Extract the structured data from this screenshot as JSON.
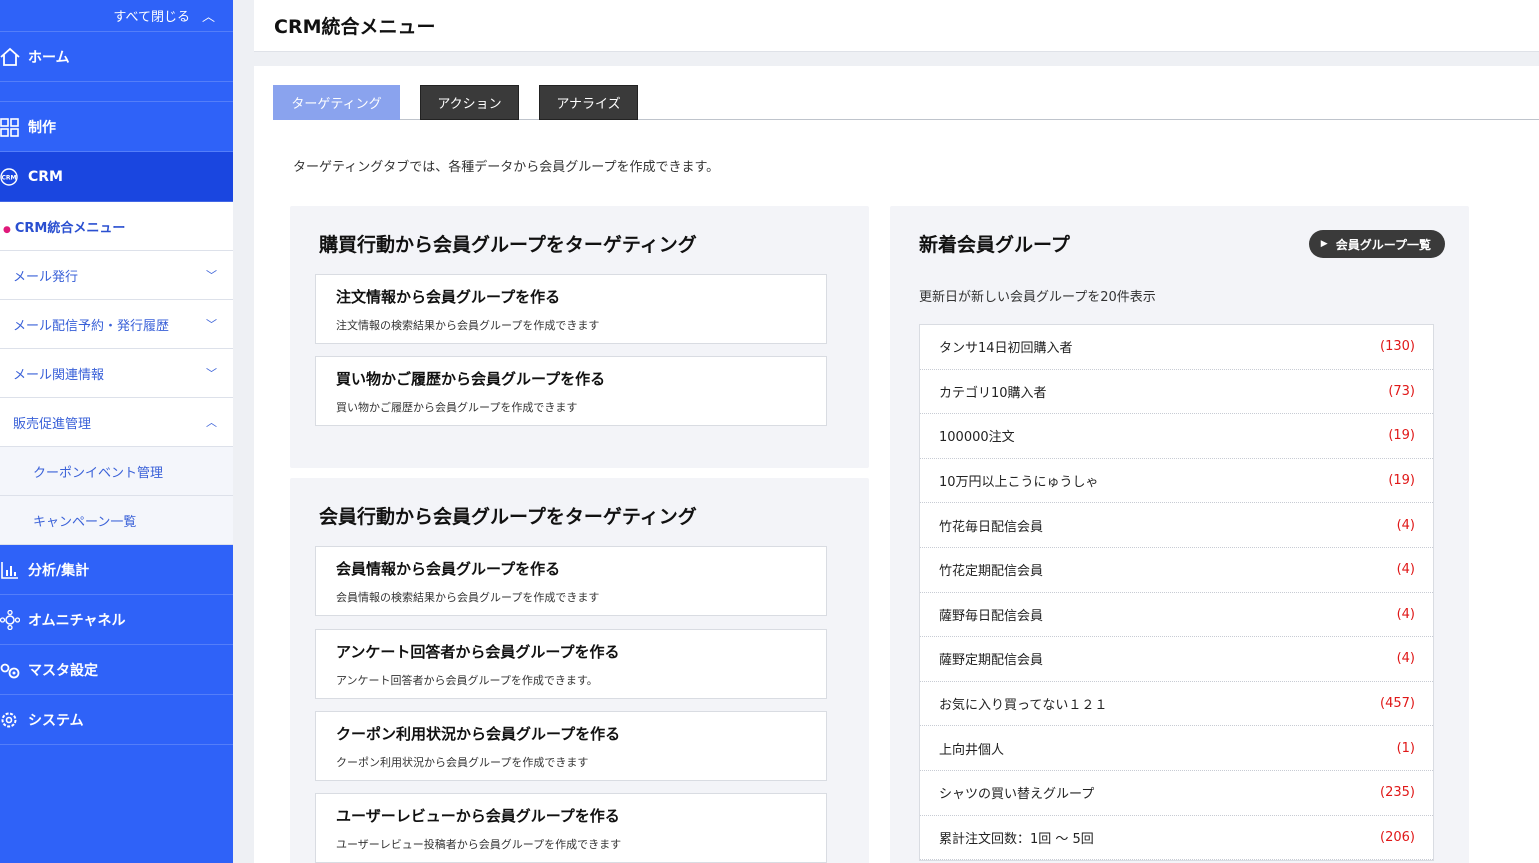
{
  "sidebar": {
    "collapse_all": "すべて閉じる",
    "home": "ホーム",
    "production": "制作",
    "crm": "CRM",
    "crm_icon_text": "CRM",
    "crm_menu": "CRM統合メニュー",
    "sub_items": [
      {
        "label": "メール発行",
        "state": "collapsed"
      },
      {
        "label": "メール配信予約・発行履歴",
        "state": "collapsed"
      },
      {
        "label": "メール関連情報",
        "state": "collapsed"
      },
      {
        "label": "販売促進管理",
        "state": "expanded"
      }
    ],
    "promo_children": [
      "クーポンイベント管理",
      "キャンペーン一覧"
    ],
    "analysis": "分析/集計",
    "omni": "オムニチャネル",
    "master": "マスタ設定",
    "system": "システム",
    "colors": {
      "bg": "#2f62f8",
      "active": "#1a46e0"
    }
  },
  "header": {
    "title": "CRM統合メニュー"
  },
  "tabs": [
    {
      "label": "ターゲティング",
      "active": true
    },
    {
      "label": "アクション",
      "active": false
    },
    {
      "label": "アナライズ",
      "active": false
    }
  ],
  "intro": "ターゲティングタブでは、各種データから会員グループを作成できます。",
  "purchase_card": {
    "title": "購買行動から会員グループをターゲティング",
    "items": [
      {
        "title": "注文情報から会員グループを作る",
        "desc": "注文情報の検索結果から会員グループを作成できます"
      },
      {
        "title": "買い物かご履歴から会員グループを作る",
        "desc": "買い物かご履歴から会員グループを作成できます"
      }
    ]
  },
  "member_card": {
    "title": "会員行動から会員グループをターゲティング",
    "items": [
      {
        "title": "会員情報から会員グループを作る",
        "desc": "会員情報の検索結果から会員グループを作成できます"
      },
      {
        "title": "アンケート回答者から会員グループを作る",
        "desc": "アンケート回答者から会員グループを作成できます。"
      },
      {
        "title": "クーポン利用状況から会員グループを作る",
        "desc": "クーポン利用状況から会員グループを作成できます"
      },
      {
        "title": "ユーザーレビューから会員グループを作る",
        "desc": "ユーザーレビュー投稿者から会員グループを作成できます"
      }
    ]
  },
  "new_groups": {
    "title": "新着会員グループ",
    "button": "会員グループ一覧",
    "note": "更新日が新しい会員グループを20件表示",
    "groups": [
      {
        "name": "タンサ14日初回購入者",
        "count": "(130)"
      },
      {
        "name": "カテゴリ10購入者",
        "count": "(73)"
      },
      {
        "name": "100000注文",
        "count": "(19)"
      },
      {
        "name": "10万円以上こうにゅうしゃ",
        "count": "(19)"
      },
      {
        "name": "竹花毎日配信会員",
        "count": "(4)"
      },
      {
        "name": "竹花定期配信会員",
        "count": "(4)"
      },
      {
        "name": "薩野毎日配信会員",
        "count": "(4)"
      },
      {
        "name": "薩野定期配信会員",
        "count": "(4)"
      },
      {
        "name": "お気に入り買ってない１２１",
        "count": "(457)"
      },
      {
        "name": "上向井個人",
        "count": "(1)"
      },
      {
        "name": "シャツの買い替えグループ",
        "count": "(235)"
      },
      {
        "name": "累計注文回数：1回 〜 5回",
        "count": "(206)"
      }
    ]
  }
}
